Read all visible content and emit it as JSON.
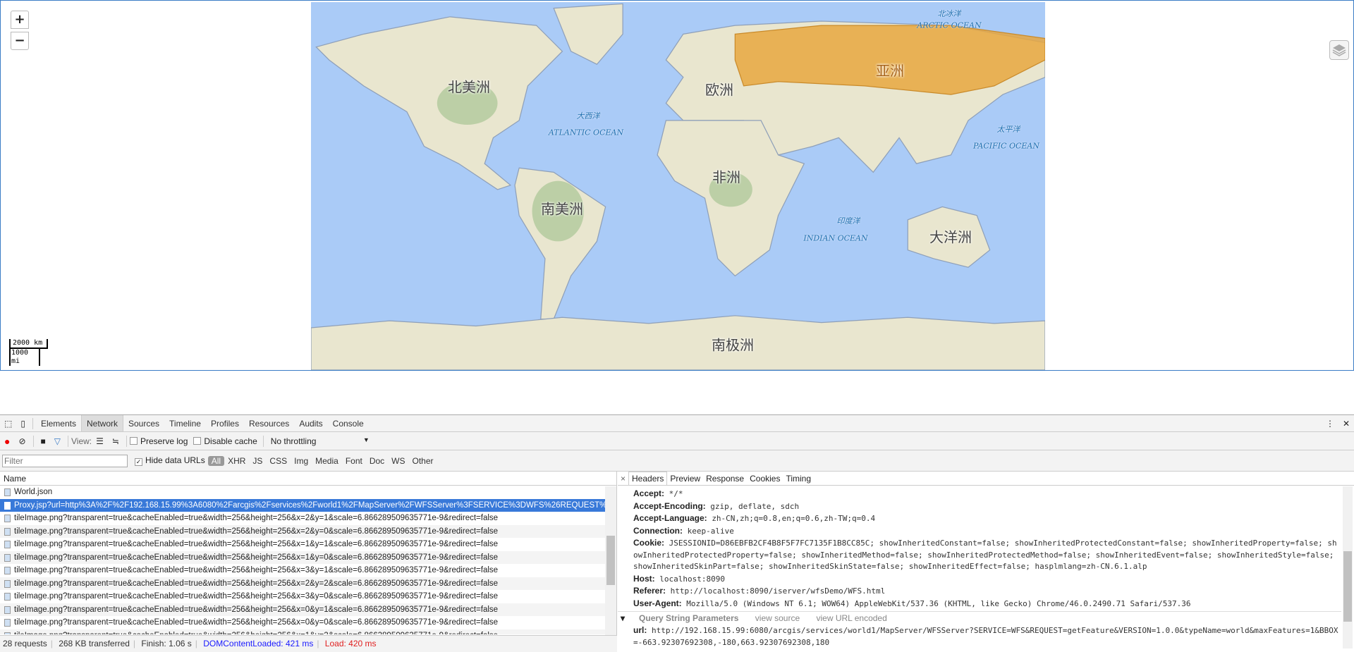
{
  "map": {
    "zoom_in": "+",
    "zoom_out": "−",
    "scale_km": "2000 km",
    "scale_mi": "1000 mi",
    "highlight_color": "#e8a740",
    "water_color": "#aacbf7",
    "labels": {
      "arctic_cn": "北冰洋",
      "arctic_en": "ARCTIC OCEAN",
      "north_america": "北美洲",
      "europe": "欧洲",
      "asia": "亚洲",
      "atlantic_cn": "大西洋",
      "atlantic_en": "ATLANTIC OCEAN",
      "pacific_cn": "太平洋",
      "pacific_en": "PACIFIC OCEAN",
      "africa": "非洲",
      "south_america": "南美洲",
      "indian_cn": "印度洋",
      "indian_en": "INDIAN OCEAN",
      "oceania": "大洋洲",
      "antarctica": "南极洲"
    }
  },
  "devtools": {
    "tabs": [
      "Elements",
      "Network",
      "Sources",
      "Timeline",
      "Profiles",
      "Resources",
      "Audits",
      "Console"
    ],
    "active_tab": "Network",
    "toolbar": {
      "view_label": "View:",
      "preserve_log": "Preserve log",
      "disable_cache": "Disable cache",
      "throttling": "No throttling"
    },
    "filter": {
      "placeholder": "Filter",
      "hide_data_urls": "Hide data URLs",
      "types": [
        "All",
        "XHR",
        "JS",
        "CSS",
        "Img",
        "Media",
        "Font",
        "Doc",
        "WS",
        "Other"
      ]
    },
    "name_header": "Name",
    "requests": [
      {
        "name": "World.json",
        "selected": false
      },
      {
        "name": "Proxy.jsp?url=http%3A%2F%2F192.168.15.99%3A6080%2Farcgis%2Fservices%2Fworld1%2FMapServer%2FWFSServer%3FSERVICE%3DWFS%26REQUEST%3...",
        "selected": true
      },
      {
        "name": "tileImage.png?transparent=true&cacheEnabled=true&width=256&height=256&x=2&y=1&scale=6.866289509635771e-9&redirect=false"
      },
      {
        "name": "tileImage.png?transparent=true&cacheEnabled=true&width=256&height=256&x=2&y=0&scale=6.866289509635771e-9&redirect=false"
      },
      {
        "name": "tileImage.png?transparent=true&cacheEnabled=true&width=256&height=256&x=1&y=1&scale=6.866289509635771e-9&redirect=false"
      },
      {
        "name": "tileImage.png?transparent=true&cacheEnabled=true&width=256&height=256&x=1&y=0&scale=6.866289509635771e-9&redirect=false"
      },
      {
        "name": "tileImage.png?transparent=true&cacheEnabled=true&width=256&height=256&x=3&y=1&scale=6.866289509635771e-9&redirect=false"
      },
      {
        "name": "tileImage.png?transparent=true&cacheEnabled=true&width=256&height=256&x=2&y=2&scale=6.866289509635771e-9&redirect=false"
      },
      {
        "name": "tileImage.png?transparent=true&cacheEnabled=true&width=256&height=256&x=3&y=0&scale=6.866289509635771e-9&redirect=false"
      },
      {
        "name": "tileImage.png?transparent=true&cacheEnabled=true&width=256&height=256&x=0&y=1&scale=6.866289509635771e-9&redirect=false"
      },
      {
        "name": "tileImage.png?transparent=true&cacheEnabled=true&width=256&height=256&x=0&y=0&scale=6.866289509635771e-9&redirect=false"
      },
      {
        "name": "tileImage.png?transparent=true&cacheEnabled=true&width=256&height=256&x=1&y=2&scale=6.866289509635771e-9&redirect=false"
      }
    ],
    "detail_tabs": [
      "Headers",
      "Preview",
      "Response",
      "Cookies",
      "Timing"
    ],
    "close": "×",
    "headers": [
      {
        "k": "Accept:",
        "v": "*/*"
      },
      {
        "k": "Accept-Encoding:",
        "v": "gzip, deflate, sdch"
      },
      {
        "k": "Accept-Language:",
        "v": "zh-CN,zh;q=0.8,en;q=0.6,zh-TW;q=0.4"
      },
      {
        "k": "Connection:",
        "v": "keep-alive"
      },
      {
        "k": "Cookie:",
        "v": "JSESSIONID=D86EBFB2CF4B8F5F7FC7135F1B8CC85C; showInheritedConstant=false; showInheritedProtectedConstant=false; showInheritedProperty=false; showInheritedProtectedProperty=false; showInheritedMethod=false; showInheritedProtectedMethod=false; showInheritedEvent=false; showInheritedStyle=false; showInheritedSkinPart=false; showInheritedSkinState=false; showInheritedEffect=false; hasplmlang=zh-CN.6.1.alp"
      },
      {
        "k": "Host:",
        "v": "localhost:8090"
      },
      {
        "k": "Referer:",
        "v": "http://localhost:8090/iserver/wfsDemo/WFS.html"
      },
      {
        "k": "User-Agent:",
        "v": "Mozilla/5.0 (Windows NT 6.1; WOW64) AppleWebKit/537.36 (KHTML, like Gecko) Chrome/46.0.2490.71 Safari/537.36"
      }
    ],
    "query": {
      "title": "Query String Parameters",
      "view_source": "view source",
      "view_encoded": "view URL encoded",
      "key": "url:",
      "value": "http://192.168.15.99:6080/arcgis/services/world1/MapServer/WFSServer?SERVICE=WFS&REQUEST=getFeature&VERSION=1.0.0&typeName=world&maxFeatures=1&BBOX=-663.92307692308,-180,663.92307692308,180"
    },
    "status": {
      "requests": "28 requests",
      "transferred": "268 KB transferred",
      "finish": "Finish: 1.06 s",
      "dcl": "DOMContentLoaded: 421 ms",
      "load": "Load: 420 ms",
      "dcl_color": "#1a1aff",
      "load_color": "#e02020"
    }
  }
}
